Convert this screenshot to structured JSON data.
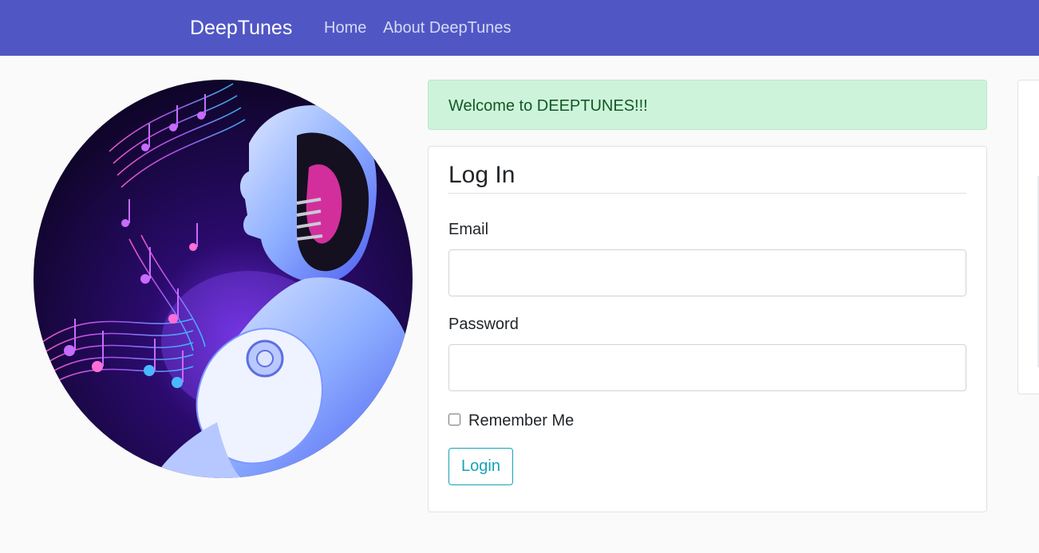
{
  "navbar": {
    "brand": "DeepTunes",
    "links": [
      "Home",
      "About DeepTunes"
    ],
    "background": "#5057c5"
  },
  "hero_image": {
    "icon": "robot-listening-music-image"
  },
  "alert": {
    "message": "Welcome to DEEPTUNES!!!",
    "background": "#cdf4db",
    "text_color": "#155724"
  },
  "login_form": {
    "title": "Log In",
    "email_label": "Email",
    "email_value": "",
    "password_label": "Password",
    "password_value": "",
    "remember_label": "Remember Me",
    "remember_checked": false,
    "submit_label": "Login",
    "accent": "#17a2b8"
  }
}
